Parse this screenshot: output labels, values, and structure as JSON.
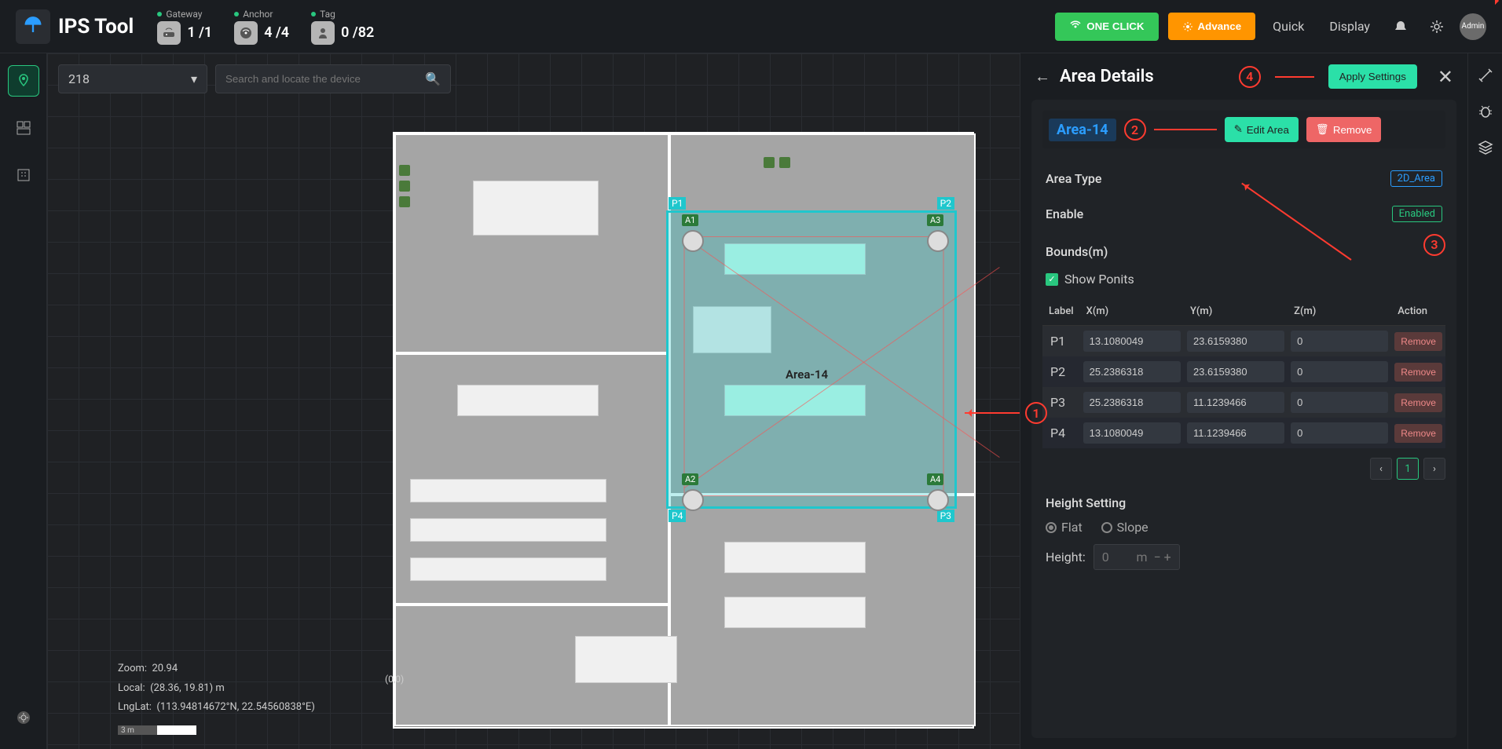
{
  "header": {
    "app_name": "IPS Tool",
    "stats": {
      "gateway": {
        "label": "Gateway",
        "value": "1 /1"
      },
      "anchor": {
        "label": "Anchor",
        "value": "4 /4"
      },
      "tag": {
        "label": "Tag",
        "value": "0 /82"
      }
    },
    "one_click": "ONE CLICK",
    "advance": "Advance",
    "quick": "Quick",
    "display": "Display",
    "user": "Admin"
  },
  "canvas": {
    "dropdown_value": "218",
    "search_placeholder": "Search and locate the device",
    "area_name": "Area-14",
    "corners": {
      "p1": "P1",
      "p2": "P2",
      "p3": "P3",
      "p4": "P4"
    },
    "anchors": {
      "a1": "A1",
      "a2": "A2",
      "a3": "A3",
      "a4": "A4"
    },
    "info": {
      "zoom_label": "Zoom:",
      "zoom_value": "20.94",
      "local_label": "Local:",
      "local_value": "(28.36,  19.81)  m",
      "lnglat_label": "LngLat:",
      "lnglat_value": "(113.94814672°N,  22.54560838°E)",
      "origin": "(0,0)",
      "scale": "3 m"
    },
    "annotations": {
      "1": "1",
      "2": "2",
      "3": "3",
      "4": "4"
    }
  },
  "panel": {
    "title": "Area Details",
    "apply": "Apply Settings",
    "area_tag": "Area-14",
    "edit": "Edit Area",
    "remove": "Remove",
    "area_type_label": "Area Type",
    "area_type_value": "2D_Area",
    "enable_label": "Enable",
    "enable_value": "Enabled",
    "bounds_label": "Bounds(m)",
    "show_points": "Show Ponits",
    "columns": {
      "label": "Label",
      "x": "X(m)",
      "y": "Y(m)",
      "z": "Z(m)",
      "action": "Action"
    },
    "points": [
      {
        "label": "P1",
        "x": "13.1080049",
        "y": "23.6159380",
        "z": "0"
      },
      {
        "label": "P2",
        "x": "25.2386318",
        "y": "23.6159380",
        "z": "0"
      },
      {
        "label": "P3",
        "x": "25.2386318",
        "y": "11.1239466",
        "z": "0"
      },
      {
        "label": "P4",
        "x": "13.1080049",
        "y": "11.1239466",
        "z": "0"
      }
    ],
    "row_remove": "Remove",
    "page": "1",
    "height_setting": "Height Setting",
    "flat": "Flat",
    "slope": "Slope",
    "height_label": "Height:",
    "height_value": "0",
    "height_unit": "m"
  }
}
